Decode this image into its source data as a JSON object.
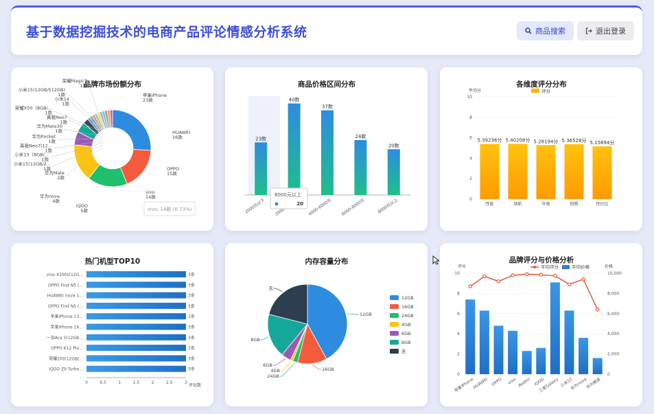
{
  "header": {
    "title": "基于数据挖掘技术的电商产品评论情感分析系统",
    "search_label": "商品搜索",
    "logout_label": "退出登录"
  },
  "colors": {
    "accent": "#3f4fd8",
    "blue": "#2d8ce0",
    "green": "#1fbf8a",
    "orange": "#ffb400"
  },
  "charts": {
    "brand_share": {
      "title": "品牌市场份额分布",
      "tooltip": "vivo: 14款 (6.73%)",
      "labels": [
        {
          "name": "荣耀Magic7",
          "count": "1款"
        },
        {
          "name": "小米15(12GB/512GB)",
          "count": "1款"
        },
        {
          "name": "小米14",
          "count": "1款"
        },
        {
          "name": "荣耀X50（8GB/...",
          "count": "1款"
        },
        {
          "name": "真我Neo7",
          "count": "1款"
        },
        {
          "name": "华为Mate30",
          "count": "1款"
        },
        {
          "name": "华为Pocket",
          "count": "1款"
        },
        {
          "name": "真我Neo7(12...",
          "count": "1款"
        },
        {
          "name": "小米13（8GB/...",
          "count": "1款"
        },
        {
          "name": "小米15(12GB/2...",
          "count": "1款"
        },
        {
          "name": "华为Mate",
          "count": "2款"
        },
        {
          "name": "华为nova",
          "count": "4款"
        },
        {
          "name": "iQOO",
          "count": "5款"
        },
        {
          "name": "vivo",
          "count": "14款"
        },
        {
          "name": "OPPO",
          "count": "15款"
        },
        {
          "name": "HUAWEI",
          "count": "16款"
        },
        {
          "name": "苹果iPhone",
          "count": "23款"
        }
      ]
    },
    "price_range": {
      "title": "商品价格区间分布",
      "tooltip_title": "8000元以上",
      "tooltip_value": "20"
    },
    "dimension_scores": {
      "title": "各维度评分分布",
      "ylabel": "平均分",
      "legend": "评分"
    },
    "top10": {
      "title": "热门机型TOP10",
      "xunit": "评论数",
      "data_label": "3条"
    },
    "storage": {
      "title": "内存容量分布"
    },
    "brand_score_price": {
      "title": "品牌评分与价格分析",
      "yleft": "评分",
      "yright": "价格",
      "legend_line": "平均评分",
      "legend_bar": "平均价格"
    }
  },
  "chart_data": [
    {
      "type": "pie",
      "title": "品牌市场份额分布",
      "categories": [
        "苹果iPhone",
        "HUAWEI",
        "OPPO",
        "vivo",
        "iQOO",
        "华为nova",
        "华为Mate",
        "小米15(12GB/2...",
        "小米13（8GB/...",
        "真我Neo7(12...",
        "华为Pocket",
        "华为Mate30",
        "真我Neo7",
        "荣耀X50（8GB/...",
        "小米14",
        "小米15(12GB/512GB)",
        "荣耀Magic7"
      ],
      "values": [
        23,
        16,
        15,
        14,
        5,
        4,
        2,
        1,
        1,
        1,
        1,
        1,
        1,
        1,
        1,
        1,
        1
      ],
      "donut": true
    },
    {
      "type": "bar",
      "title": "商品价格区间分布",
      "categories": [
        "2000元以下",
        "2000-4000元",
        "4000-6000元",
        "6000-8000元",
        "8000元以上"
      ],
      "values": [
        23,
        40,
        37,
        24,
        20
      ],
      "value_suffix": "款"
    },
    {
      "type": "bar",
      "title": "各维度评分分布",
      "categories": [
        "性能",
        "续航",
        "外观",
        "拍照",
        "性价比"
      ],
      "values": [
        5.39236,
        5.40208,
        5.28194,
        5.36528,
        5.15694
      ],
      "ylabel": "平均分",
      "ylim": [
        0,
        10
      ],
      "value_suffix": "分",
      "legend": [
        "评分"
      ]
    },
    {
      "type": "bar",
      "orientation": "horizontal",
      "title": "热门机型TOP10",
      "categories": [
        "vivo X100s(12G...",
        "OPPO Find N5 (...",
        "HUAWEI nova 1...",
        "OPPO Find N5 (...",
        "苹果iPhone 13...",
        "苹果iPhone 16...",
        "一加Ace 5(12GB...",
        "OPPO K12 Plu...",
        "荣耀200(12GB/...",
        "iQOO Z9 Turbo..."
      ],
      "values": [
        3,
        3,
        3,
        3,
        3,
        3,
        3,
        3,
        3,
        3
      ],
      "xlim": [
        0,
        3
      ],
      "xlabel": "评论数",
      "value_suffix": "条"
    },
    {
      "type": "pie",
      "title": "内存容量分布",
      "categories": [
        "12GB",
        "16GB",
        "24GB",
        "4GB",
        "6GB",
        "8GB",
        "无"
      ],
      "values": [
        42,
        12,
        2,
        1,
        4,
        18,
        21
      ],
      "legend": [
        "12GB",
        "16GB",
        "24GB",
        "4GB",
        "6GB",
        "8GB",
        "无"
      ]
    },
    {
      "type": "bar",
      "title": "品牌评分与价格分析",
      "categories": [
        "苹果iPhone",
        "HUAWEI",
        "OPPO",
        "vivo",
        "Redmi",
        "iQOO",
        "三星Galaxy",
        "小米15",
        "华为nova",
        "华为畅享"
      ],
      "series": [
        {
          "name": "平均价格",
          "type": "bar",
          "axis": "right",
          "values": [
            7400,
            6300,
            4800,
            4300,
            2300,
            2600,
            9100,
            6300,
            3600,
            1600
          ]
        },
        {
          "name": "平均评分",
          "type": "line",
          "axis": "left",
          "values": [
            8.7,
            9.7,
            9.2,
            9.8,
            9.9,
            9.85,
            9.75,
            8.9,
            9.4,
            6.4
          ]
        }
      ],
      "ylim_left": [
        0,
        10
      ],
      "ylim_right": [
        0,
        10000
      ],
      "ylabel_left": "评分",
      "ylabel_right": "价格"
    }
  ]
}
